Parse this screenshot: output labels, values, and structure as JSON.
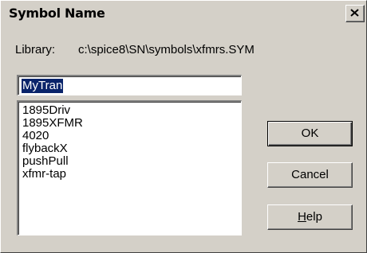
{
  "window": {
    "title": "Symbol Name"
  },
  "library": {
    "label": "Library:",
    "path": "c:\\spice8\\SN\\symbols\\xfmrs.SYM"
  },
  "name_input": {
    "value": "MyTran"
  },
  "symbols": [
    "1895Driv",
    "1895XFMR",
    "4020",
    "flybackX",
    "pushPull",
    "xfmr-tap"
  ],
  "buttons": {
    "ok": "OK",
    "cancel": "Cancel",
    "help_hotkey": "H",
    "help_rest": "elp"
  },
  "icons": {
    "close": "close-icon"
  },
  "colors": {
    "selection": "#0a246a",
    "face": "#d4d0c8"
  }
}
